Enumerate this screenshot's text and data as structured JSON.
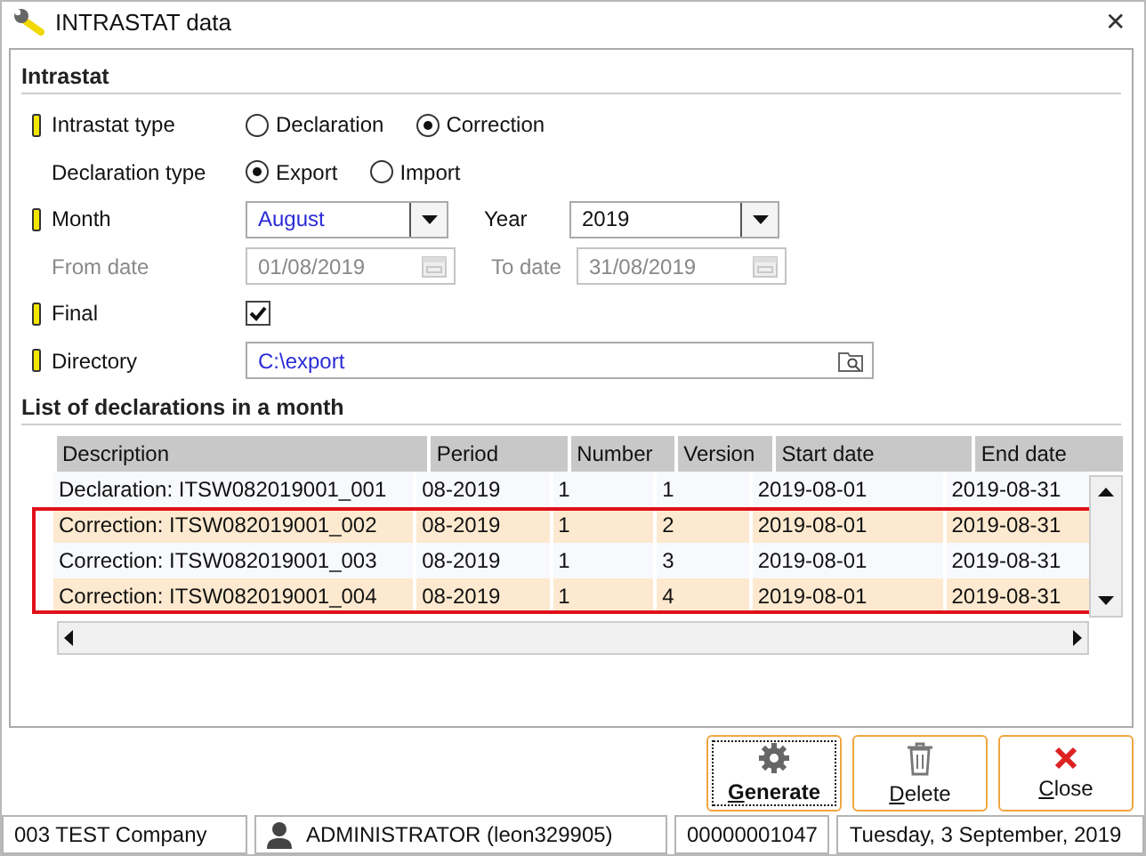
{
  "window": {
    "title": "INTRASTAT data",
    "close": "✕"
  },
  "intrastat": {
    "heading": "Intrastat",
    "intrastat_type": {
      "label": "Intrastat type",
      "required": true,
      "options": [
        {
          "label": "Declaration",
          "selected": false
        },
        {
          "label": "Correction",
          "selected": true
        }
      ]
    },
    "declaration_type": {
      "label": "Declaration type",
      "required": false,
      "options": [
        {
          "label": "Export",
          "selected": true
        },
        {
          "label": "Import",
          "selected": false
        }
      ]
    },
    "month": {
      "label": "Month",
      "required": true,
      "value": "August"
    },
    "year": {
      "label": "Year",
      "value": "2019"
    },
    "from_date": {
      "label": "From date",
      "value": "01/08/2019",
      "disabled": true
    },
    "to_date": {
      "label": "To date",
      "value": "31/08/2019",
      "disabled": true
    },
    "final": {
      "label": "Final",
      "required": true,
      "checked": true
    },
    "directory": {
      "label": "Directory",
      "required": true,
      "value": "C:\\export"
    }
  },
  "declarations": {
    "heading": "List of declarations in a month",
    "columns": [
      "Description",
      "Period",
      "Number",
      "Version",
      "Start date",
      "End date"
    ],
    "rows": [
      {
        "cells": [
          "Declaration: ITSW082019001_001",
          "08-2019",
          "1",
          "1",
          "2019-08-01",
          "2019-08-31"
        ],
        "marked": false
      },
      {
        "cells": [
          "Correction: ITSW082019001_002",
          "08-2019",
          "1",
          "2",
          "2019-08-01",
          "2019-08-31"
        ],
        "marked": true
      },
      {
        "cells": [
          "Correction: ITSW082019001_003",
          "08-2019",
          "1",
          "3",
          "2019-08-01",
          "2019-08-31"
        ],
        "marked": true
      },
      {
        "cells": [
          "Correction: ITSW082019001_004",
          "08-2019",
          "1",
          "4",
          "2019-08-01",
          "2019-08-31"
        ],
        "marked": true
      }
    ]
  },
  "buttons": [
    {
      "label": "Generate",
      "kind": "gear",
      "focused": true
    },
    {
      "label": "Delete",
      "kind": "trash",
      "focused": false
    },
    {
      "label": "Close",
      "kind": "close",
      "focused": false
    }
  ],
  "status_bar": {
    "company": "003 TEST Company",
    "user": "ADMINISTRATOR (leon329905)",
    "number": "00000001047",
    "date": "Tuesday, 3 September, 2019"
  }
}
